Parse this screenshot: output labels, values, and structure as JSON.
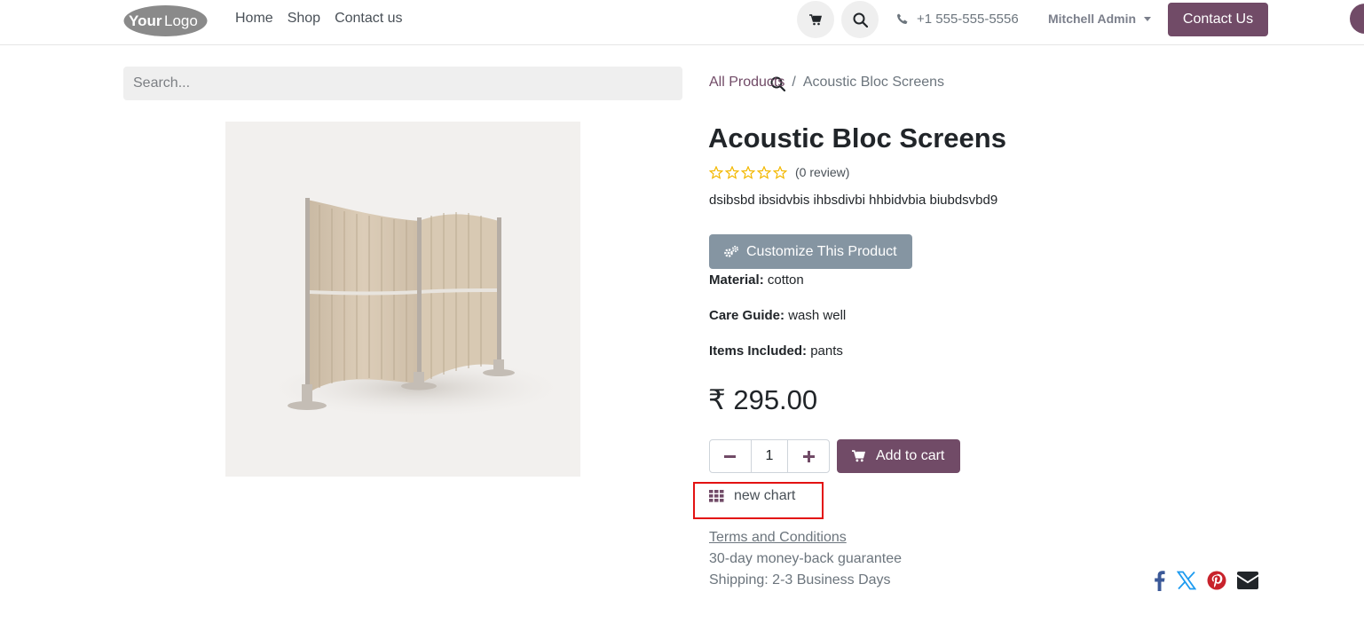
{
  "header": {
    "logo_text_your": "Your",
    "logo_text_logo": "Logo",
    "nav": [
      "Home",
      "Shop",
      "Contact us"
    ],
    "phone": "+1 555-555-5556",
    "user": "Mitchell Admin",
    "contact_button": "Contact Us"
  },
  "search": {
    "placeholder": "Search..."
  },
  "breadcrumb": {
    "parent": "All Products",
    "separator": "/",
    "current": "Acoustic Bloc Screens"
  },
  "product": {
    "title": "Acoustic Bloc Screens",
    "review_count": "(0 review)",
    "rating": 0,
    "description": "dsibsbd ibsidvbis ihbsdivbi hhbidvbia biubdsvbd9",
    "customize_label": "Customize This Product",
    "attributes": [
      {
        "label": "Material:",
        "value": "cotton"
      },
      {
        "label": "Care Guide:",
        "value": "wash well"
      },
      {
        "label": "Items Included:",
        "value": "pants"
      }
    ],
    "price": "₹ 295.00",
    "quantity": "1",
    "add_to_cart": "Add to cart",
    "chart_link": "new chart",
    "terms": "Terms and Conditions",
    "guarantee": "30-day money-back guarantee",
    "shipping": "Shipping: 2-3 Business Days"
  },
  "colors": {
    "primary": "#714b67",
    "secondary": "#8595a2",
    "highlight": "#e31212"
  },
  "icons": [
    "cart-icon",
    "search-icon",
    "phone-icon",
    "gears-icon",
    "minus-icon",
    "plus-icon",
    "grid-icon",
    "facebook-icon",
    "x-icon",
    "pinterest-icon",
    "envelope-icon"
  ]
}
